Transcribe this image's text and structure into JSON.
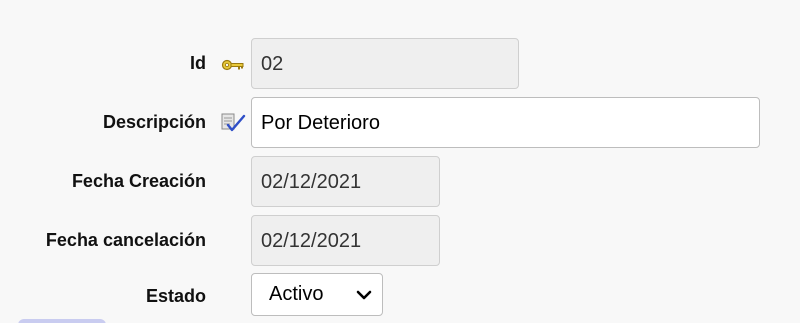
{
  "form": {
    "id": {
      "label": "Id",
      "value": "02"
    },
    "descripcion": {
      "label": "Descripción",
      "value": "Por Deterioro"
    },
    "fecha_creacion": {
      "label": "Fecha Creación",
      "value": "02/12/2021"
    },
    "fecha_cancelacion": {
      "label": "Fecha cancelación",
      "value": "02/12/2021"
    },
    "estado": {
      "label": "Estado",
      "selected": "Activo"
    }
  },
  "icons": {
    "id_icon": "key-icon",
    "descripcion_icon": "required-check-icon",
    "estado_dropdown": "chevron-down-icon"
  },
  "colors": {
    "page_background": "#f8f8f8",
    "readonly_field": "#efefef",
    "key_gold": "#d9b62a",
    "check_blue": "#2f4fc7",
    "button_lilac": "#c9ccf0"
  }
}
